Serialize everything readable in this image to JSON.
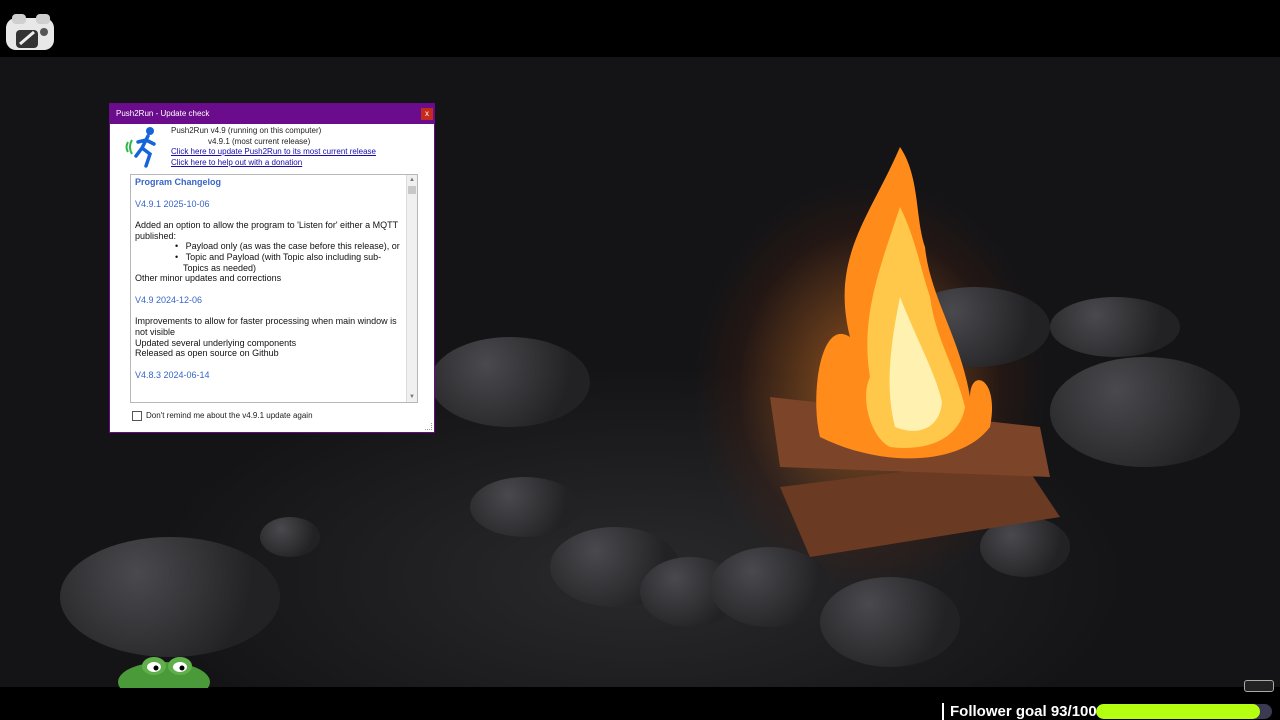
{
  "dialog": {
    "title": "Push2Run - Update check",
    "close_label": "x",
    "app_icon": "running-man-with-sound-waves-icon",
    "current_version": "Push2Run v4.9 (running on this computer)",
    "latest_version": "v4.9.1 (most current release)",
    "update_link": "Click here to update Push2Run to its most current release",
    "donate_link": "Click here to help out with a donation",
    "reminder_checkbox": {
      "label": "Don't remind me about the v4.9.1 update again",
      "checked": false
    },
    "changelog": {
      "title": "Program Changelog",
      "entries": [
        {
          "version": "V4.9.1 2025-10-06",
          "intro": "Added an option to allow the program to 'Listen for' either a MQTT published:",
          "bullets": [
            "Payload only (as was the case before this release), or",
            "Topic and Payload (with Topic also including sub-Topics as needed)"
          ],
          "outro": "Other minor updates and corrections"
        },
        {
          "version": "V4.9 2024-12-06",
          "lines": [
            "Improvements to allow for faster processing when main window is not visible",
            "Updated several underlying components",
            "Released as open source on Github"
          ]
        },
        {
          "version": "V4.8.3 2024-06-14"
        }
      ]
    }
  },
  "overlay": {
    "logo_icon": "cartoon-face-logo-icon",
    "mascot_icon": "green-frog-mascot-icon",
    "follower_goal": {
      "label": "Follower goal 93/100",
      "current": 93,
      "target": 100,
      "fill_color": "#b5ff10"
    }
  },
  "background": {
    "scene_icon": "campfire-on-river-rocks"
  }
}
